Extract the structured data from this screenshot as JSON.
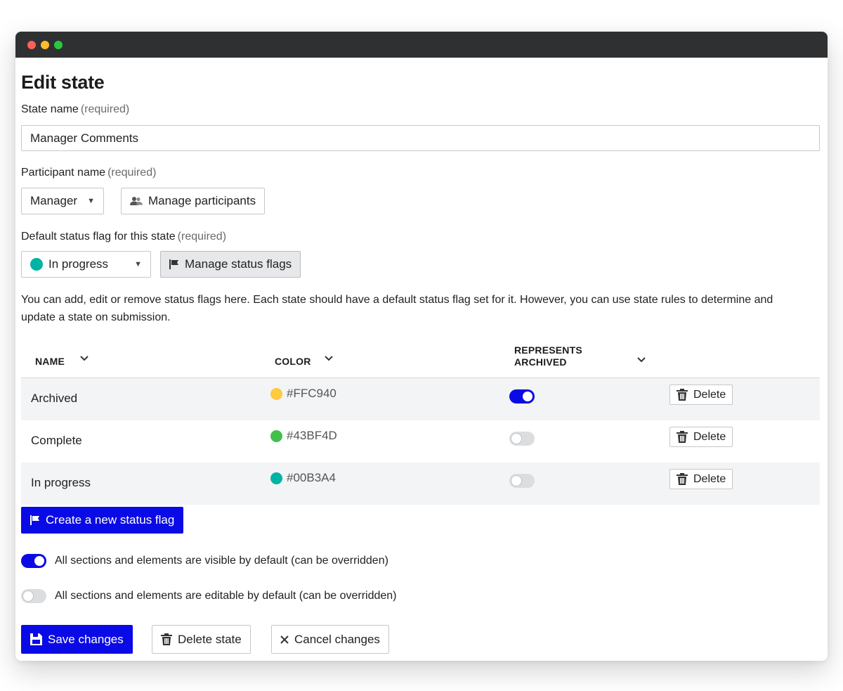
{
  "page": {
    "title": "Edit state"
  },
  "state_name": {
    "label": "State name",
    "required": "(required)",
    "value": "Manager Comments"
  },
  "participant": {
    "label": "Participant name",
    "required": "(required)",
    "selected": "Manager",
    "manage_label": "Manage participants"
  },
  "status_flag": {
    "label": "Default status flag for this state",
    "required": "(required)",
    "selected": "In progress",
    "selected_color": "#00B3A4",
    "manage_label": "Manage status flags"
  },
  "help_text": "You can add, edit or remove status flags here. Each state should have a default status flag set for it. However, you can use state rules to determine and update a state on submission.",
  "table": {
    "headers": {
      "name": "NAME",
      "color": "COLOR",
      "archived_line1": "REPRESENTS",
      "archived_line2": "ARCHIVED"
    },
    "rows": [
      {
        "name": "Archived",
        "color": "#FFC940",
        "archived": true,
        "delete_label": "Delete"
      },
      {
        "name": "Complete",
        "color": "#43BF4D",
        "archived": false,
        "delete_label": "Delete"
      },
      {
        "name": "In progress",
        "color": "#00B3A4",
        "archived": false,
        "delete_label": "Delete"
      }
    ]
  },
  "create_flag_label": "Create a new status flag",
  "switches": {
    "visible": {
      "label": "All sections and elements are visible by default (can be overridden)",
      "on": true
    },
    "editable": {
      "label": "All sections and elements are editable by default (can be overridden)",
      "on": false
    }
  },
  "footer": {
    "save_label": "Save changes",
    "delete_label": "Delete state",
    "cancel_label": "Cancel changes"
  },
  "colors": {
    "primary": "#0a0ae6",
    "titlebar": "#2f3032",
    "close": "#ff5f57",
    "minimize": "#febc2e",
    "maximize": "#28c840"
  }
}
